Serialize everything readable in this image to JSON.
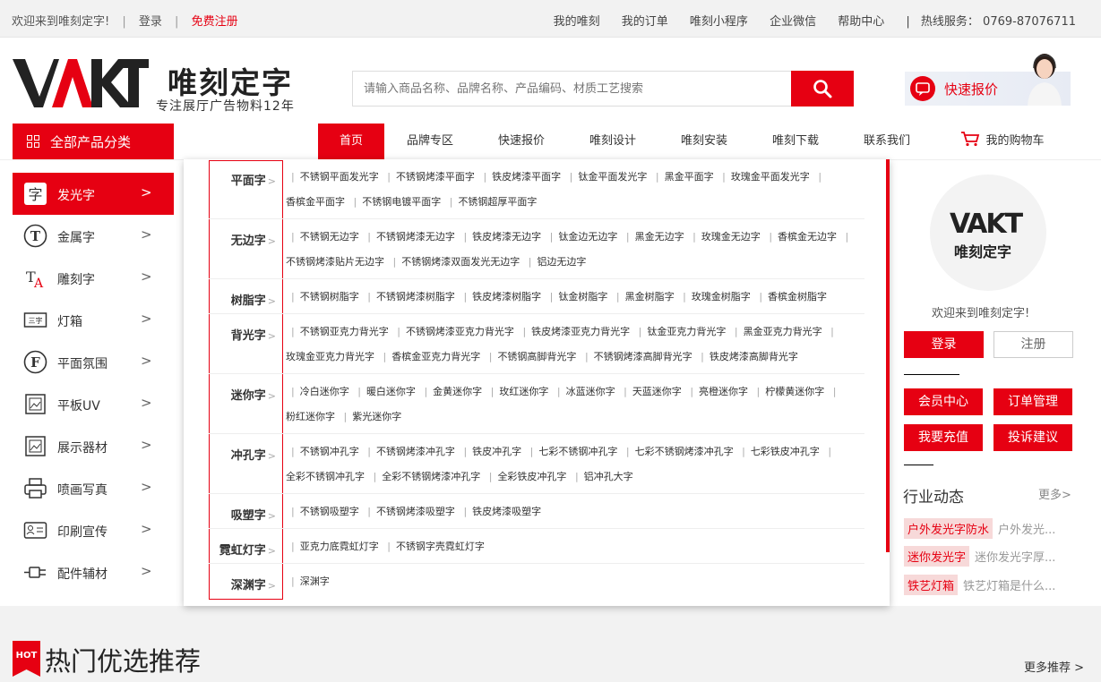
{
  "topbar": {
    "welcome": "欢迎来到唯刻定字!",
    "sep": "|",
    "login": "登录",
    "register": "免费注册",
    "links": [
      "我的唯刻",
      "我的订单",
      "唯刻小程序",
      "企业微信",
      "帮助中心"
    ],
    "hotline": "热线服务：  0769-87076711"
  },
  "header": {
    "logo_mark": "VAKT",
    "logo_name": "唯刻定字",
    "logo_slogan": "专注展厅广告物料12年",
    "search_placeholder": "请输入商品名称、品牌名称、产品编码、材质工艺搜索",
    "quote_label": "快速报价"
  },
  "nav": {
    "all_categories": "全部产品分类",
    "items": [
      "首页",
      "品牌专区",
      "快速报价",
      "唯刻设计",
      "唯刻安装",
      "唯刻下载",
      "联系我们",
      "我的购物车"
    ]
  },
  "sidebar": {
    "items": [
      "发光字",
      "金属字",
      "雕刻字",
      "灯箱",
      "平面氛围",
      "平板UV",
      "展示器材",
      "喷画写真",
      "印刷宣传",
      "配件辅材"
    ]
  },
  "panel": {
    "rows": [
      {
        "cat": "平面字",
        "links": [
          "不锈钢平面发光字",
          "不锈钢烤漆平面字",
          "铁皮烤漆平面字",
          "钛金平面发光字",
          "黑金平面字",
          "玫瑰金平面发光字",
          "香槟金平面字",
          "不锈钢电镀平面字",
          "不锈钢超厚平面字"
        ]
      },
      {
        "cat": "无边字",
        "links": [
          "不锈钢无边字",
          "不锈钢烤漆无边字",
          "铁皮烤漆无边字",
          "钛金边无边字",
          "黑金无边字",
          "玫瑰金无边字",
          "香槟金无边字",
          "不锈钢烤漆贴片无边字",
          "不锈钢烤漆双面发光无边字",
          "铝边无边字"
        ]
      },
      {
        "cat": "树脂字",
        "links": [
          "不锈钢树脂字",
          "不锈钢烤漆树脂字",
          "铁皮烤漆树脂字",
          "钛金树脂字",
          "黑金树脂字",
          "玫瑰金树脂字",
          "香槟金树脂字"
        ]
      },
      {
        "cat": "背光字",
        "links": [
          "不锈钢亚克力背光字",
          "不锈钢烤漆亚克力背光字",
          "铁皮烤漆亚克力背光字",
          "钛金亚克力背光字",
          "黑金亚克力背光字",
          "玫瑰金亚克力背光字",
          "香槟金亚克力背光字",
          "不锈钢高脚背光字",
          "不锈钢烤漆高脚背光字",
          "铁皮烤漆高脚背光字"
        ]
      },
      {
        "cat": "迷你字",
        "links": [
          "冷白迷你字",
          "暖白迷你字",
          "金黄迷你字",
          "玫红迷你字",
          "冰蓝迷你字",
          "天蓝迷你字",
          "亮橙迷你字",
          "柠檬黄迷你字",
          "粉红迷你字",
          "紫光迷你字"
        ]
      },
      {
        "cat": "冲孔字",
        "links": [
          "不锈钢冲孔字",
          "不锈钢烤漆冲孔字",
          "铁皮冲孔字",
          "七彩不锈钢冲孔字",
          "七彩不锈钢烤漆冲孔字",
          "七彩铁皮冲孔字",
          "全彩不锈钢冲孔字",
          "全彩不锈钢烤漆冲孔字",
          "全彩铁皮冲孔字",
          "铝冲孔大字"
        ]
      },
      {
        "cat": "吸塑字",
        "links": [
          "不锈钢吸塑字",
          "不锈钢烤漆吸塑字",
          "铁皮烤漆吸塑字"
        ]
      },
      {
        "cat": "霓虹灯字",
        "links": [
          "亚克力底霓虹灯字",
          "不锈钢字壳霓虹灯字"
        ]
      },
      {
        "cat": "深渊字",
        "links": [
          "深渊字"
        ]
      }
    ]
  },
  "user": {
    "avatar_mark": "VAKT",
    "avatar_name": "唯刻定字",
    "welcome": "欢迎来到唯刻定字!",
    "login": "登录",
    "register": "注册",
    "quick": [
      "会员中心",
      "订单管理",
      "我要充值",
      "投诉建议"
    ]
  },
  "news": {
    "title": "行业动态",
    "more": "更多>",
    "items": [
      {
        "tag": "户外发光字防水",
        "text": "户外发光..."
      },
      {
        "tag": "迷你发光字",
        "text": "迷你发光字厚..."
      },
      {
        "tag": "铁艺灯箱",
        "text": "铁艺灯箱是什么..."
      }
    ]
  },
  "hot": {
    "badge": "HOT",
    "title": "热门优选推荐",
    "more": "更多推荐 >"
  },
  "colors": {
    "accent": "#e60012"
  }
}
